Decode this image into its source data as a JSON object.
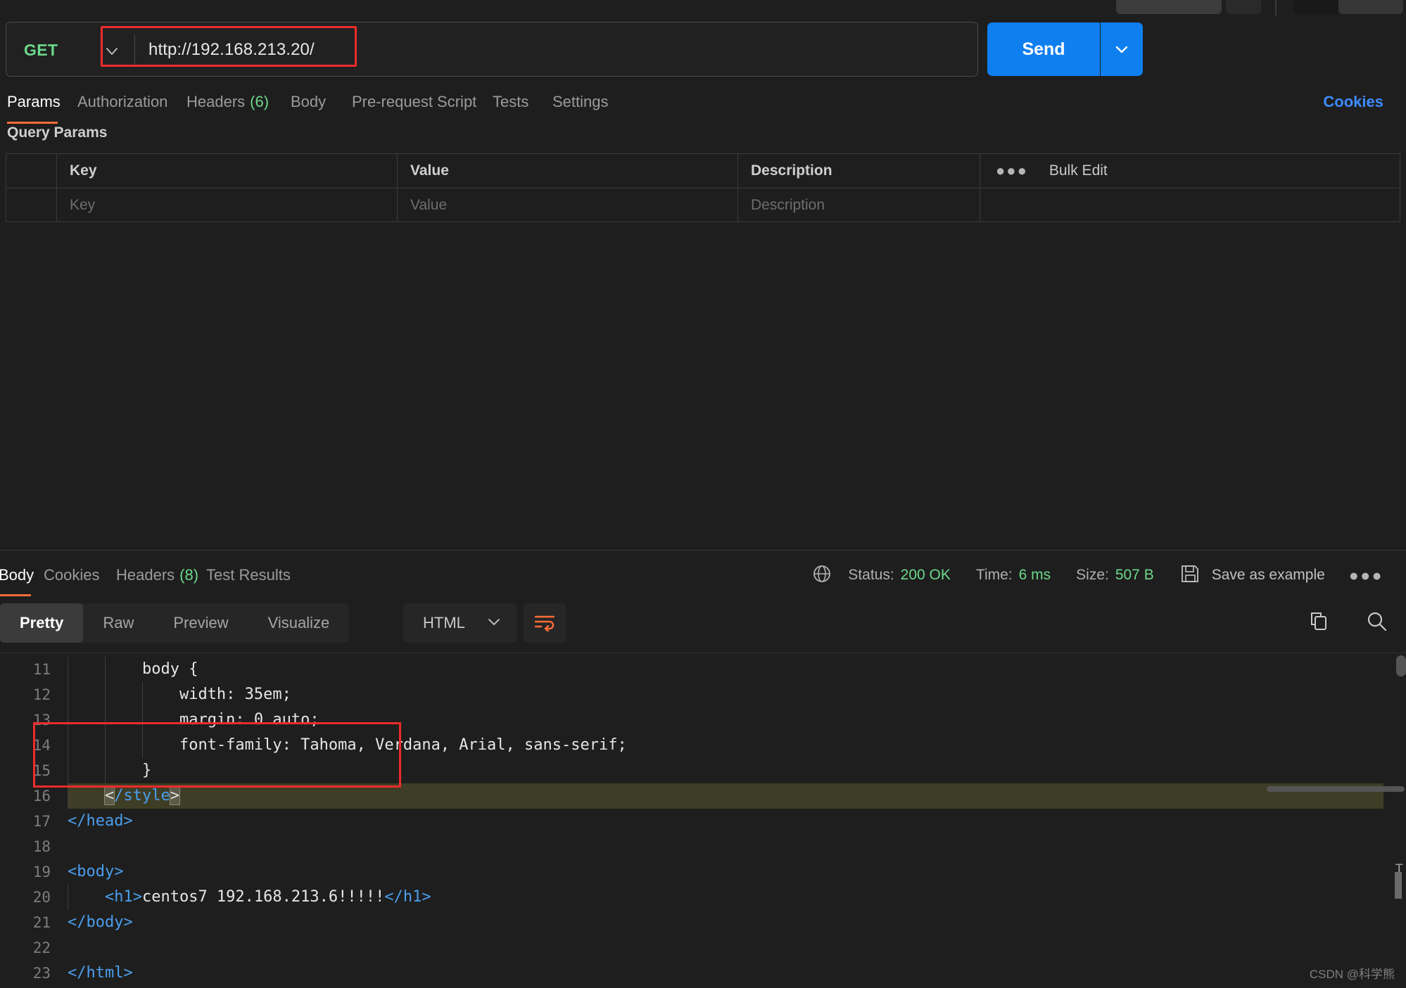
{
  "app": {
    "theme": "dark"
  },
  "request": {
    "method": "GET",
    "url": "http://192.168.213.20/",
    "send_label": "Send",
    "tabs": [
      {
        "label": "Params",
        "count": null,
        "active": true
      },
      {
        "label": "Authorization",
        "count": null,
        "active": false
      },
      {
        "label": "Headers",
        "count": "(6)",
        "active": false
      },
      {
        "label": "Body",
        "count": null,
        "active": false
      },
      {
        "label": "Pre-request Script",
        "count": null,
        "active": false
      },
      {
        "label": "Tests",
        "count": null,
        "active": false
      },
      {
        "label": "Settings",
        "count": null,
        "active": false
      }
    ],
    "cookies_link": "Cookies"
  },
  "query_params": {
    "title": "Query Params",
    "columns": [
      "Key",
      "Value",
      "Description"
    ],
    "bulk_edit_label": "Bulk Edit",
    "rows": [
      {
        "key": "Key",
        "value": "Value",
        "description": "Description"
      }
    ]
  },
  "response": {
    "tabs": [
      {
        "label": "Body",
        "count": null,
        "active": true
      },
      {
        "label": "Cookies",
        "count": null,
        "active": false
      },
      {
        "label": "Headers",
        "count": "(8)",
        "active": false
      },
      {
        "label": "Test Results",
        "count": null,
        "active": false
      }
    ],
    "status_label": "Status:",
    "status_value": "200 OK",
    "time_label": "Time:",
    "time_value": "6 ms",
    "size_label": "Size:",
    "size_value": "507 B",
    "save_example_label": "Save as example",
    "view_modes": [
      {
        "label": "Pretty",
        "active": true
      },
      {
        "label": "Raw",
        "active": false
      },
      {
        "label": "Preview",
        "active": false
      },
      {
        "label": "Visualize",
        "active": false
      }
    ],
    "format": "HTML",
    "code_lines": [
      {
        "num": "11",
        "indent": 2,
        "segments": [
          {
            "t": "txt",
            "s": "body {"
          }
        ],
        "highlight": false
      },
      {
        "num": "12",
        "indent": 3,
        "segments": [
          {
            "t": "txt",
            "s": "width: 35em;"
          }
        ],
        "highlight": false
      },
      {
        "num": "13",
        "indent": 3,
        "segments": [
          {
            "t": "txt",
            "s": "margin: 0 auto;"
          }
        ],
        "highlight": false
      },
      {
        "num": "14",
        "indent": 3,
        "segments": [
          {
            "t": "txt",
            "s": "font-family: Tahoma, Verdana, Arial, sans-serif;"
          }
        ],
        "highlight": false
      },
      {
        "num": "15",
        "indent": 2,
        "segments": [
          {
            "t": "txt",
            "s": "}"
          }
        ],
        "highlight": false
      },
      {
        "num": "16",
        "indent": 1,
        "segments": [
          {
            "t": "brk",
            "s": "<"
          },
          {
            "t": "tag",
            "s": "/style"
          },
          {
            "t": "brk",
            "s": ">"
          }
        ],
        "highlight": true
      },
      {
        "num": "17",
        "indent": 0,
        "segments": [
          {
            "t": "tag",
            "s": "</head>"
          }
        ],
        "highlight": false
      },
      {
        "num": "18",
        "indent": 0,
        "segments": [
          {
            "t": "txt",
            "s": ""
          }
        ],
        "highlight": false
      },
      {
        "num": "19",
        "indent": 0,
        "segments": [
          {
            "t": "tag",
            "s": "<body>"
          }
        ],
        "highlight": false
      },
      {
        "num": "20",
        "indent": 1,
        "segments": [
          {
            "t": "tag",
            "s": "<h1>"
          },
          {
            "t": "txt",
            "s": "centos7 192.168.213.6!!!!!"
          },
          {
            "t": "tag",
            "s": "</h1>"
          }
        ],
        "highlight": false
      },
      {
        "num": "21",
        "indent": 0,
        "segments": [
          {
            "t": "tag",
            "s": "</body>"
          }
        ],
        "highlight": false
      },
      {
        "num": "22",
        "indent": 0,
        "segments": [
          {
            "t": "txt",
            "s": ""
          }
        ],
        "highlight": false
      },
      {
        "num": "23",
        "indent": 0,
        "segments": [
          {
            "t": "tag",
            "s": "</html>"
          }
        ],
        "highlight": false
      }
    ],
    "scroll_marker": "T"
  },
  "watermark": "CSDN @科学熊",
  "colors": {
    "accent_orange": "#ff6c37",
    "send_blue": "#0f7ff0",
    "link_blue": "#3d8bff",
    "success_green": "#6cd98a",
    "highlight_red": "#ef2b2b",
    "background": "#1e1e1e"
  }
}
